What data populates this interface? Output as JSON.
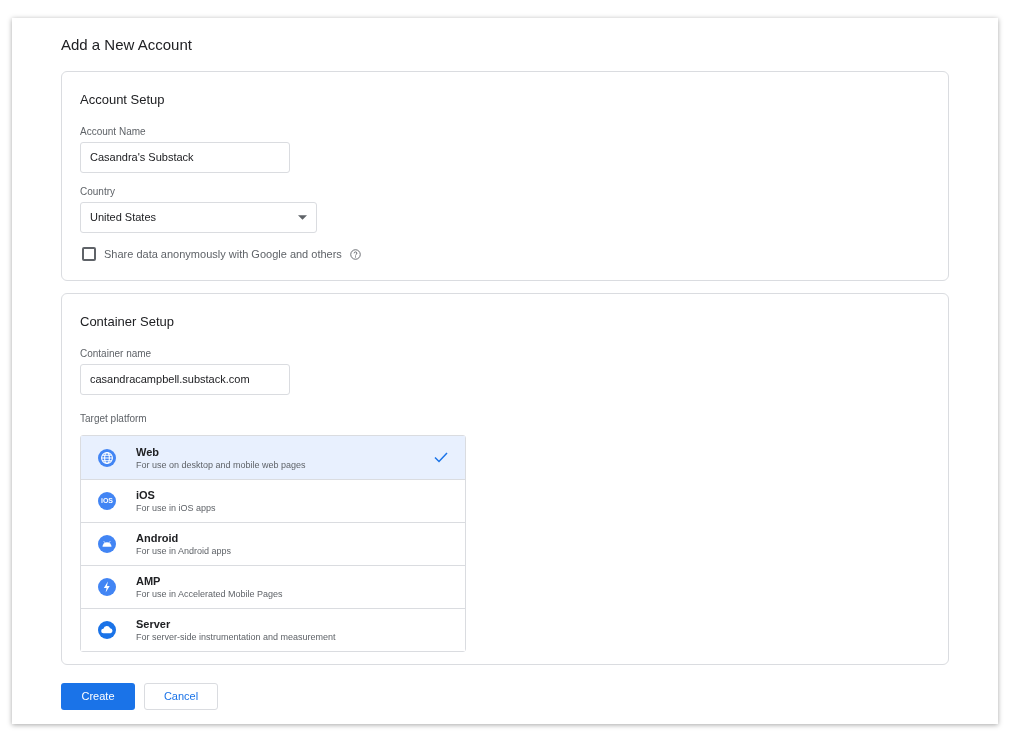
{
  "title": "Add a New Account",
  "account_setup": {
    "heading": "Account Setup",
    "account_name": {
      "label": "Account Name",
      "value": "Casandra's Substack"
    },
    "country": {
      "label": "Country",
      "value": "United States"
    },
    "share_data": {
      "label": "Share data anonymously with Google and others",
      "checked": false
    }
  },
  "container_setup": {
    "heading": "Container Setup",
    "container_name": {
      "label": "Container name",
      "value": "casandracampbell.substack.com"
    },
    "target_platform_label": "Target platform",
    "platforms": [
      {
        "kind": "web",
        "name": "Web",
        "description": "For use on desktop and mobile web pages",
        "selected": true
      },
      {
        "kind": "ios",
        "icon_label": "iOS",
        "name": "iOS",
        "description": "For use in iOS apps",
        "selected": false
      },
      {
        "kind": "android",
        "name": "Android",
        "description": "For use in Android apps",
        "selected": false
      },
      {
        "kind": "amp",
        "name": "AMP",
        "description": "For use in Accelerated Mobile Pages",
        "selected": false
      },
      {
        "kind": "server",
        "name": "Server",
        "description": "For server-side instrumentation and measurement",
        "selected": false
      }
    ]
  },
  "buttons": {
    "create": "Create",
    "cancel": "Cancel"
  }
}
